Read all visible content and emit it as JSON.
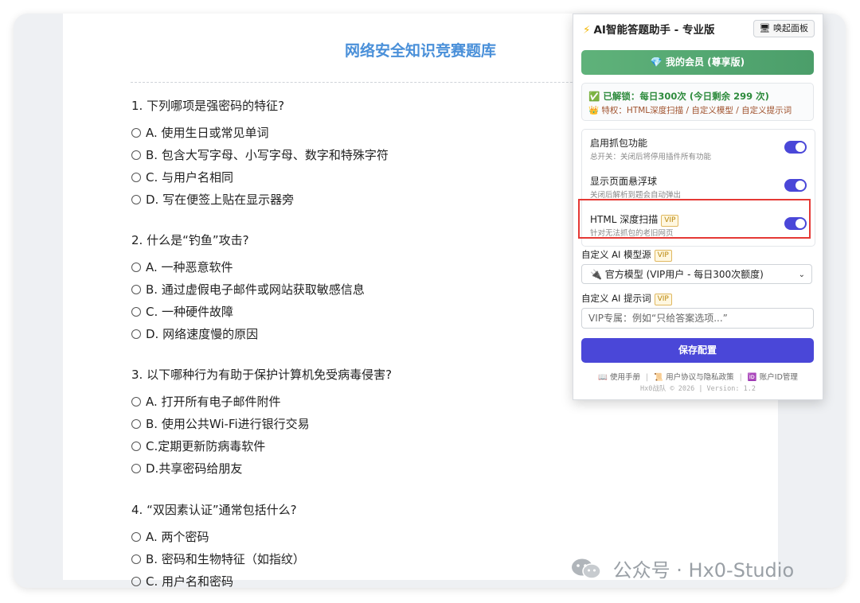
{
  "quiz": {
    "title": "网络安全知识竞赛题库",
    "questions": [
      {
        "text": "1. 下列哪项是强密码的特征?",
        "options": [
          "A. 使用生日或常见单词",
          "B. 包含大写字母、小写字母、数字和特殊字符",
          "C. 与用户名相同",
          "D. 写在便签上贴在显示器旁"
        ]
      },
      {
        "text": "2. 什么是“钓鱼”攻击?",
        "options": [
          "A. 一种恶意软件",
          "B. 通过虚假电子邮件或网站获取敏感信息",
          "C. 一种硬件故障",
          "D. 网络速度慢的原因"
        ]
      },
      {
        "text": "3. 以下哪种行为有助于保护计算机免受病毒侵害?",
        "options": [
          "A. 打开所有电子邮件附件",
          "B. 使用公共Wi-Fi进行银行交易",
          "C.定期更新防病毒软件",
          "D.共享密码给朋友"
        ]
      },
      {
        "text": "4. “双因素认证”通常包括什么?",
        "options": [
          "A. 两个密码",
          "B. 密码和生物特征（如指纹）",
          "C. 用户名和密码"
        ]
      }
    ]
  },
  "panel": {
    "title": "AI智能答题助手 - 专业版",
    "awake_button": "唤起面板",
    "member_button": "我的会员 (尊享版)",
    "status_line1": "已解锁：每日300次 (今日剩余 299 次)",
    "status_line2": "特权：HTML深度扫描 / 自定义模型 / 自定义提示词",
    "settings": [
      {
        "title": "启用抓包功能",
        "subtitle": "总开关：关闭后将停用插件所有功能",
        "enabled": true
      },
      {
        "title": "显示页面悬浮球",
        "subtitle": "关闭后解析到题会自动弹出",
        "enabled": true
      },
      {
        "title": "HTML 深度扫描",
        "subtitle": "针对无法抓包的老旧网页",
        "enabled": true,
        "vip": "VIP"
      }
    ],
    "model_label": "自定义 AI 模型源",
    "model_vip": "VIP",
    "model_value": "官方模型 (VIP用户 - 每日300次额度)",
    "prompt_label": "自定义 AI 提示词",
    "prompt_vip": "VIP",
    "prompt_placeholder": "VIP专属：例如“只给答案选项...”",
    "save_button": "保存配置",
    "links": [
      "使用手册",
      "用户协议与隐私政策",
      "账户ID管理"
    ],
    "copyright": "Hx0战队 © 2026 | Version: 1.2"
  },
  "watermark": "公众号 · Hx0-Studio",
  "colors": {
    "accent": "#4a47d8",
    "member_green": "#4b9e6a",
    "highlight_red": "#e53935",
    "title_blue": "#4a90d9"
  }
}
